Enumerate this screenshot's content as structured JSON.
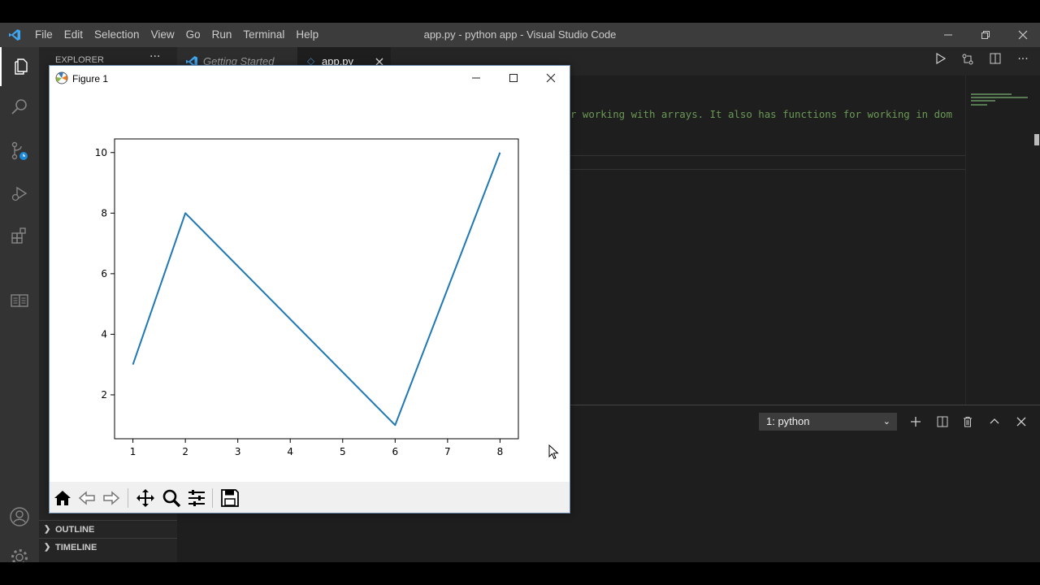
{
  "vscode": {
    "menu": [
      "File",
      "Edit",
      "Selection",
      "View",
      "Go",
      "Run",
      "Terminal",
      "Help"
    ],
    "window_title": "app.py - python app - Visual Studio Code",
    "sidebar": {
      "header": "EXPLORER",
      "more": "···",
      "sections": [
        "OUTLINE",
        "TIMELINE"
      ]
    },
    "tabs": [
      {
        "label": "Getting Started",
        "italic": true
      },
      {
        "label": "app.py",
        "active": true
      }
    ],
    "code_line": "r working with arrays. It also has functions for working in dom",
    "terminal": {
      "selected": "1: python"
    },
    "colors": {
      "accent": "#007acc",
      "comment": "#6a9955",
      "line": "#1f77b4"
    }
  },
  "figure": {
    "title": "Figure 1",
    "toolbar": [
      "home-icon",
      "back-icon",
      "forward-icon",
      "pan-icon",
      "zoom-icon",
      "configure-icon",
      "save-icon"
    ]
  },
  "chart_data": {
    "type": "line",
    "x": [
      1,
      2,
      6,
      8
    ],
    "y": [
      3,
      8,
      1,
      10
    ],
    "xticks": [
      1,
      2,
      3,
      4,
      5,
      6,
      7,
      8
    ],
    "yticks": [
      2,
      4,
      6,
      8,
      10
    ],
    "xlim": [
      0.65,
      8.35
    ],
    "ylim": [
      0.55,
      10.45
    ],
    "title": "",
    "xlabel": "",
    "ylabel": "",
    "color": "#1f77b4",
    "grid": false
  }
}
